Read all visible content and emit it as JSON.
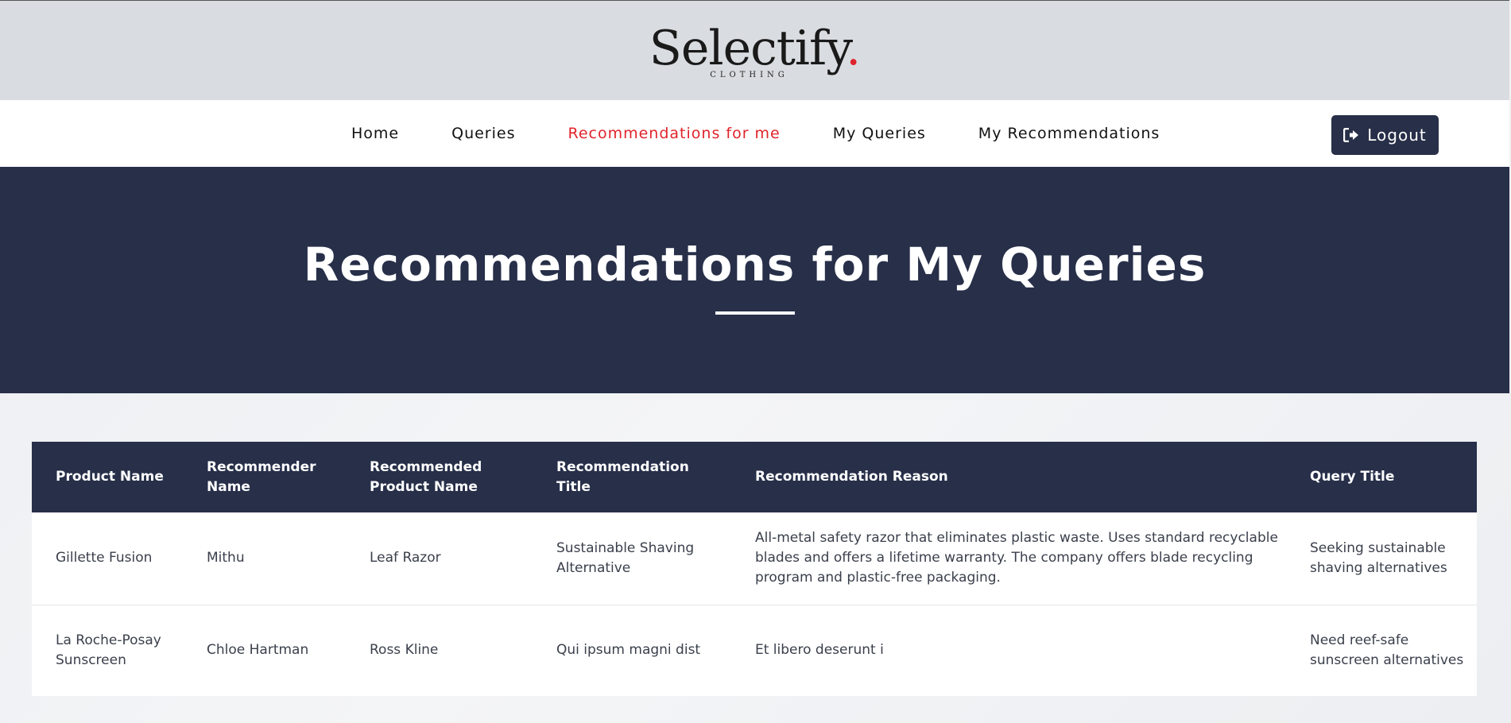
{
  "brand": {
    "name": "Selectify",
    "dot": ".",
    "tagline": "CLOTHING"
  },
  "nav": {
    "items": [
      {
        "label": "Home",
        "active": false
      },
      {
        "label": "Queries",
        "active": false
      },
      {
        "label": "Recommendations for me",
        "active": true
      },
      {
        "label": "My Queries",
        "active": false
      },
      {
        "label": "My Recommendations",
        "active": false
      }
    ],
    "logout_label": "Logout"
  },
  "hero": {
    "title": "Recommendations for My Queries"
  },
  "table": {
    "headers": [
      "Product Name",
      "Recommender Name",
      "Recommended Product Name",
      "Recommendation Title",
      "Recommendation Reason",
      "Query Title"
    ],
    "rows": [
      [
        "Gillette Fusion",
        "Mithu",
        "Leaf Razor",
        "Sustainable Shaving Alternative",
        "All-metal safety razor that eliminates plastic waste. Uses standard recyclable blades and offers a lifetime warranty. The company offers blade recycling program and plastic-free packaging.",
        "Seeking sustainable shaving alternatives"
      ],
      [
        "La Roche-Posay Sunscreen",
        "Chloe Hartman",
        "Ross Kline",
        "Qui ipsum magni dist",
        "Et libero deserunt i",
        "Need reef-safe sunscreen alternatives"
      ]
    ]
  },
  "colors": {
    "accent": "#e0242b",
    "navy": "#272f49"
  }
}
